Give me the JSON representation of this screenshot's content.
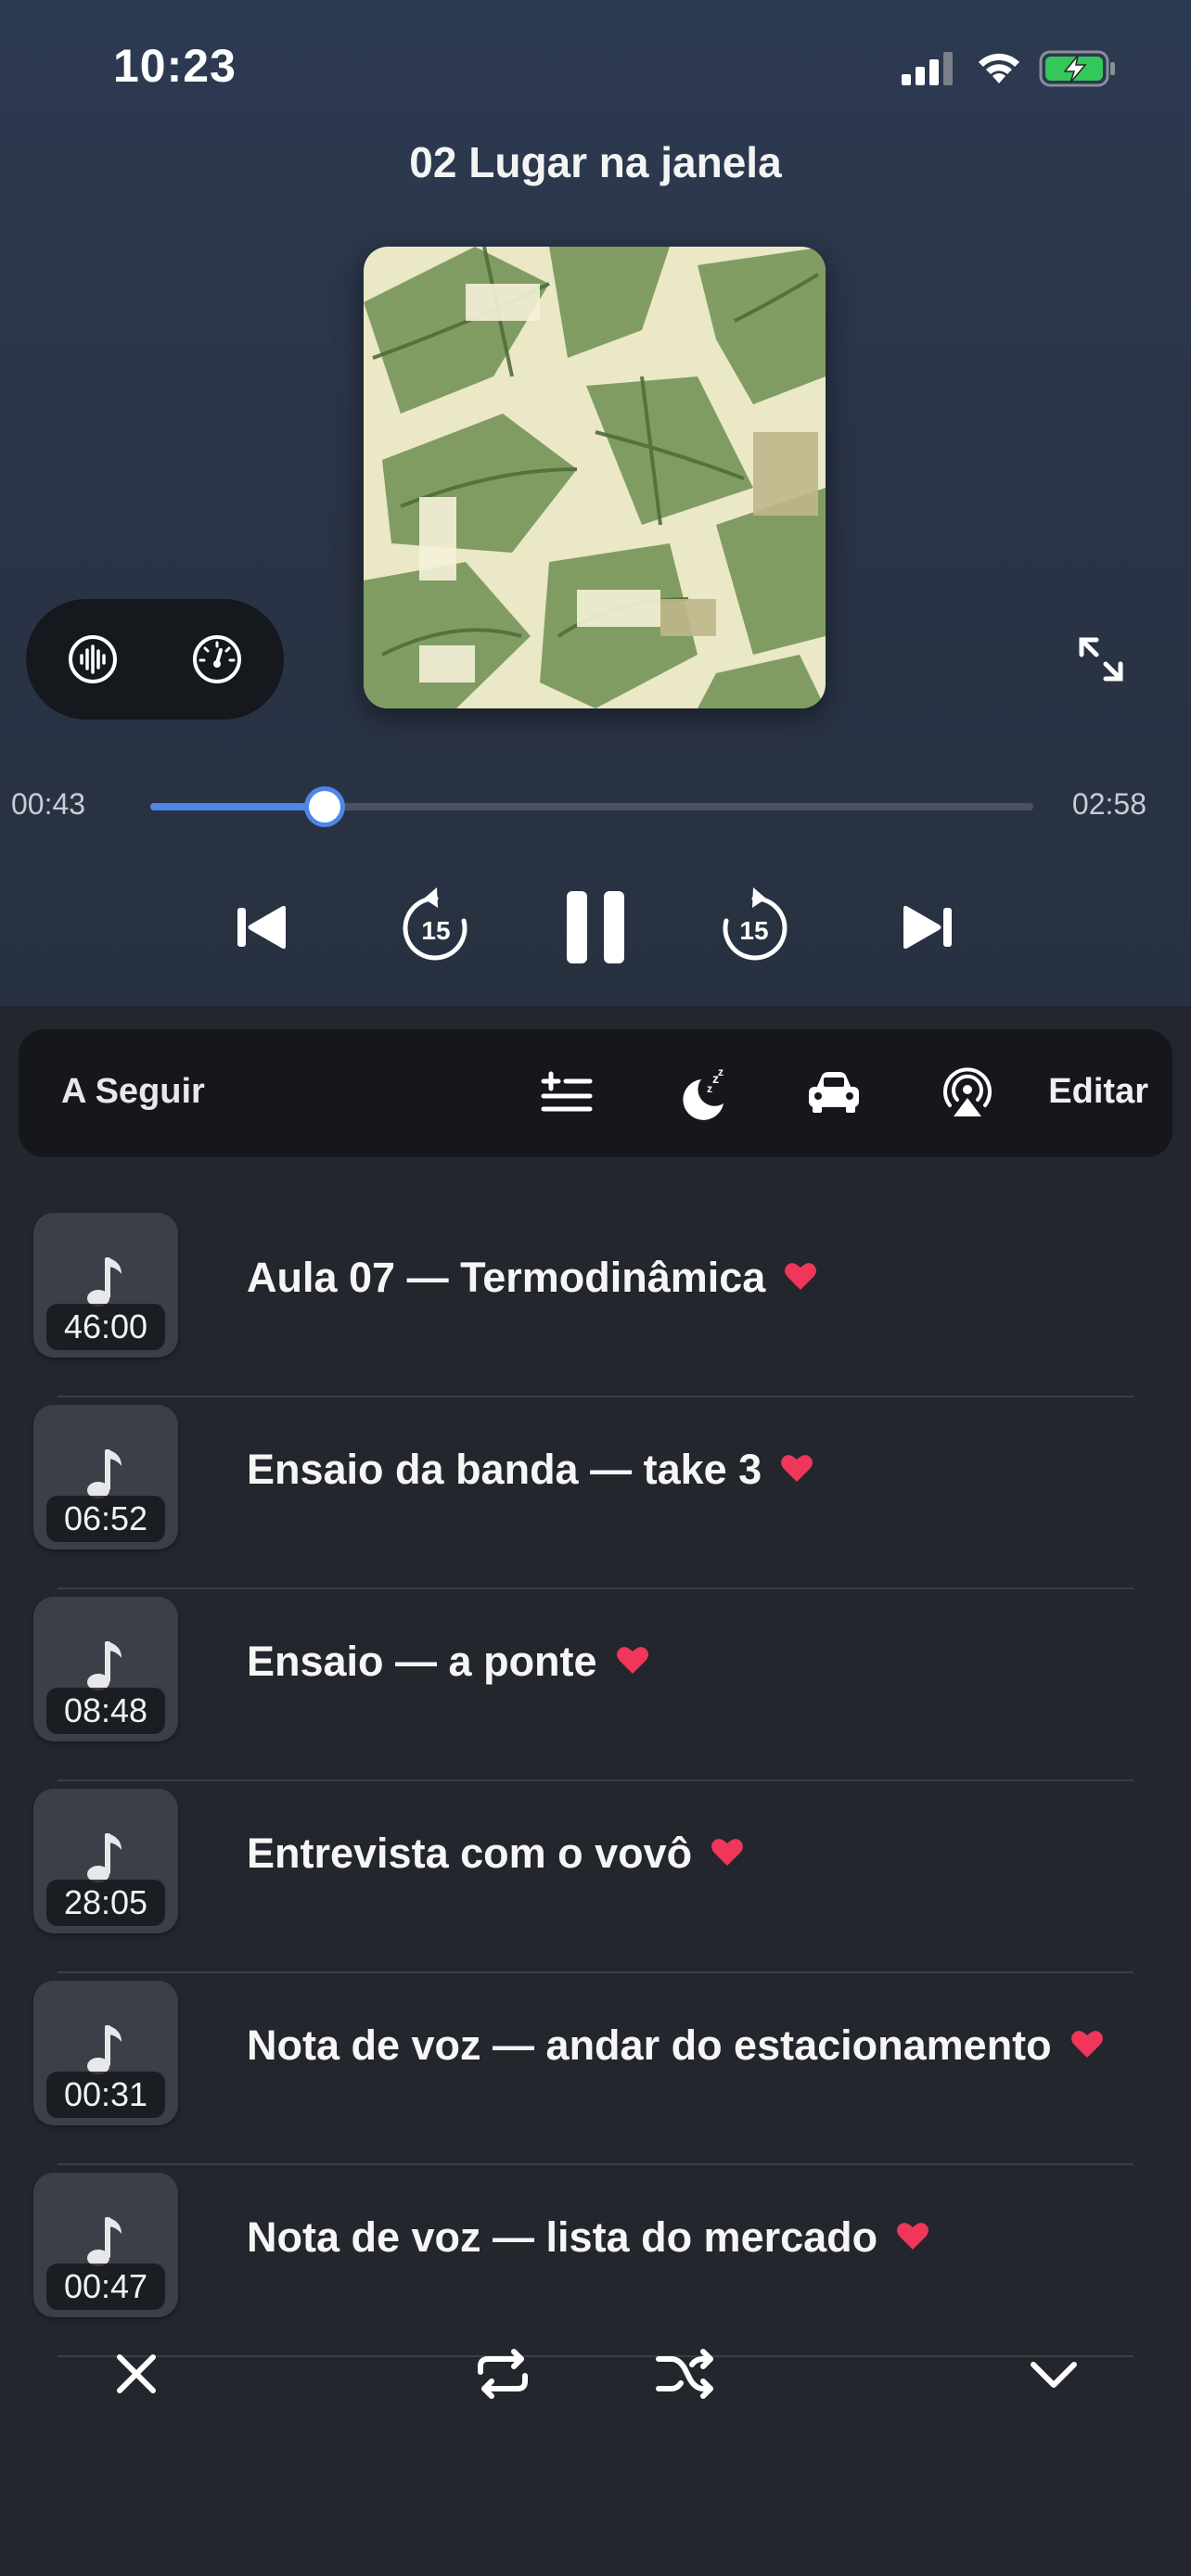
{
  "status_bar": {
    "time": "10:23"
  },
  "now_playing": {
    "title": "02 Lugar na janela",
    "elapsed": "00:43",
    "total": "02:58",
    "progress": 0.198,
    "rewind_seconds": "15",
    "forward_seconds": "15"
  },
  "toolbar": {
    "label": "A Seguir",
    "edit_label": "Editar"
  },
  "queue": [
    {
      "title": "Aula 07 — Termodinâmica",
      "duration": "46:00"
    },
    {
      "title": "Ensaio da banda — take 3",
      "duration": "06:52"
    },
    {
      "title": "Ensaio — a ponte",
      "duration": "08:48"
    },
    {
      "title": "Entrevista com o vovô",
      "duration": "28:05"
    },
    {
      "title": "Nota de voz — andar do estacionamento",
      "duration": "00:31"
    },
    {
      "title": "Nota de voz — lista do mercado",
      "duration": "00:47"
    }
  ],
  "colors": {
    "accent": "#4d86e6",
    "heart": "#f0365a",
    "battery": "#34c759"
  }
}
